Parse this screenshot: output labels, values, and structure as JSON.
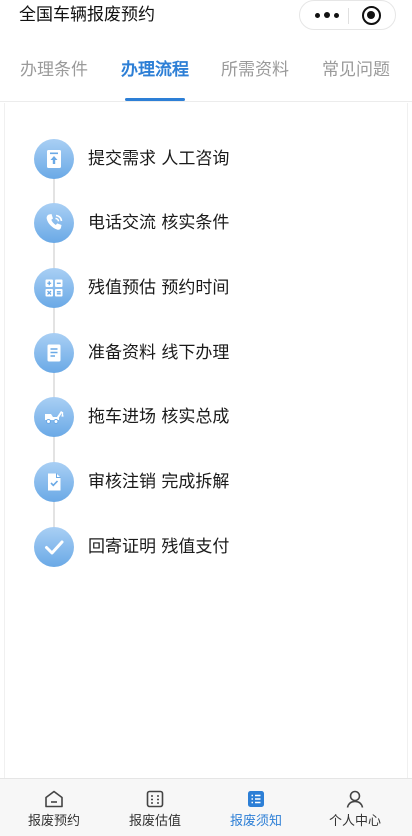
{
  "header": {
    "title": "全国车辆报废预约"
  },
  "tabs": [
    {
      "label": "办理条件"
    },
    {
      "label": "办理流程"
    },
    {
      "label": "所需资料"
    },
    {
      "label": "常见问题"
    }
  ],
  "active_tab": 1,
  "steps": [
    {
      "label": "提交需求 人工咨询",
      "icon": "upload-document-icon"
    },
    {
      "label": "电话交流 核实条件",
      "icon": "phone-icon"
    },
    {
      "label": "残值预估 预约时间",
      "icon": "calculator-icon"
    },
    {
      "label": "准备资料 线下办理",
      "icon": "document-icon"
    },
    {
      "label": "拖车进场 核实总成",
      "icon": "tow-truck-icon"
    },
    {
      "label": "审核注销 完成拆解",
      "icon": "checked-document-icon"
    },
    {
      "label": "回寄证明 残值支付",
      "icon": "checkmark-icon"
    }
  ],
  "bottom_nav": [
    {
      "label": "报废预约",
      "icon": "home-icon"
    },
    {
      "label": "报废估值",
      "icon": "calculator-icon"
    },
    {
      "label": "报废须知",
      "icon": "list-icon"
    },
    {
      "label": "个人中心",
      "icon": "user-icon"
    }
  ],
  "colors": {
    "accent": "#2d7fd6",
    "icon_gradient_top": "#a9cff4",
    "icon_gradient_bottom": "#6aa9e6"
  }
}
